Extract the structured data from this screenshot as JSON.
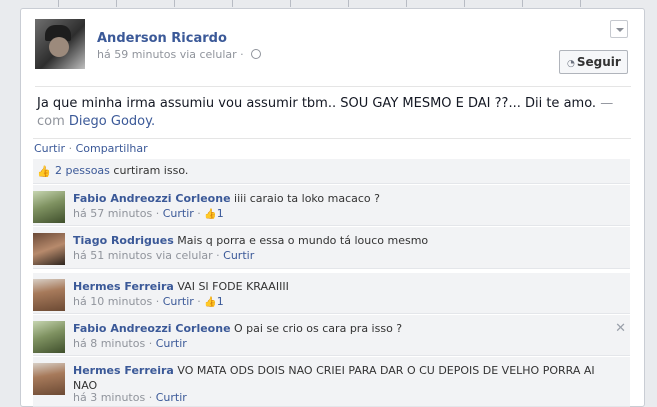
{
  "post": {
    "author": "Anderson Ricardo",
    "meta": "há 59 minutos via celular",
    "follow_label": "Seguir",
    "status_text": "Ja que minha irma assumiu vou assumir tbm.. SOU GAY MESMO E DAI ??... Dii te amo.",
    "with_prefix": " — com ",
    "tagged": "Diego Godoy",
    "tagged_suffix": "."
  },
  "actions": {
    "like": "Curtir",
    "separator": " · ",
    "share": "Compartilhar"
  },
  "likes": {
    "count": "2 pessoas",
    "text": " curtiram isso."
  },
  "comments": [
    {
      "name": "Fabio Andreozzi Corleone",
      "text": " iiii caraio ta loko macaco ?",
      "time": "há 57 minutos",
      "like": "Curtir",
      "likes": "1"
    },
    {
      "name": "Tiago Rodrigues",
      "text": " Mais q porra e essa o mundo tá louco mesmo",
      "time": "há 51 minutos via celular",
      "like": "Curtir"
    },
    {
      "name": "Hermes Ferreira",
      "text": " VAI SI FODE KRAAIIII",
      "time": "há 10 minutos",
      "like": "Curtir",
      "likes": "1"
    },
    {
      "name": "Fabio Andreozzi Corleone",
      "text": " O pai se crio os cara pra isso ?",
      "time": "há 8 minutos",
      "like": "Curtir",
      "close": "✕"
    },
    {
      "name": "Hermes Ferreira",
      "text": " VO MATA ODS DOIS NAO CRIEI PARA DAR O CU DEPOIS DE VELHO PORRA AI NAO",
      "time": "há 3 minutos",
      "like": "Curtir"
    }
  ],
  "colors": {
    "link": "#3b5998",
    "muted": "#90949c",
    "panel": "#f2f3f5"
  },
  "icons": {
    "privacy": "globe-icon",
    "follow": "rss-icon",
    "menu": "chevron-down-icon",
    "like": "thumbs-up-icon",
    "remove": "close-icon"
  }
}
